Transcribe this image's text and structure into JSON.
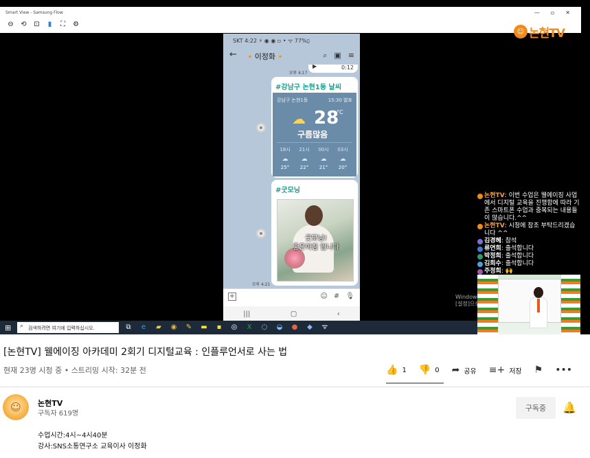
{
  "smart_view": {
    "title": "Smart View - Samsung Flow",
    "icons": [
      "minus-circle-icon",
      "rotate-icon",
      "crop-icon",
      "phone-icon",
      "fullscreen-icon",
      "settings-icon"
    ],
    "window_controls": [
      "—",
      "▫",
      "✕"
    ]
  },
  "logo": {
    "text": "논현TV"
  },
  "phone": {
    "status": "SKT 4:22 ⚡ ◉ ◉ ▫ •   ᯤ 77%▯",
    "chat_name": "🔸이정화🔸",
    "messages": [
      {
        "time": "오후 4:17",
        "partial_label": "0:12"
      },
      {
        "title": "#강남구 논현1동 날씨",
        "location": "강남구 논현1동",
        "updated": "15:30 발표",
        "temperature": "28",
        "unit": "°C",
        "condition": "구름많음",
        "forecast": [
          {
            "hour": "18시",
            "temp": "25°"
          },
          {
            "hour": "21시",
            "temp": "22°"
          },
          {
            "hour": "00시",
            "temp": "21°"
          },
          {
            "hour": "03시",
            "temp": "20°"
          }
        ]
      },
      {
        "title": "#굿모닝",
        "image_text_1": "굿모닝!",
        "image_text_2": "좋은아침 입니다",
        "time": "오후 4:21"
      }
    ]
  },
  "live_chat": [
    {
      "name": "논현TV",
      "text": ": 이번 수업은 웰에이징 사업에서 디지털 교육을 진행함에 따라 기존 스마트폰 수업과 중복되는 내용들이 많습니다.^^",
      "color": "#f08a1c"
    },
    {
      "name": "논현TV",
      "text": ": 시청에 참조 부탁드리겠습니다 ^^",
      "color": "#f08a1c"
    },
    {
      "name": "김경혜",
      "text": ": 참석",
      "color": "#7c6fd6"
    },
    {
      "name": "류연희",
      "text": ": 출석합니다",
      "color": "#3b7bd6"
    },
    {
      "name": "박정희",
      "text": ": 출석합니다",
      "color": "#2e9b6a"
    },
    {
      "name": "김희수",
      "text": ": 출석합니다",
      "color": "#4aa3d8"
    },
    {
      "name": "주정희",
      "text": ": 🙌",
      "color": "#9b59b6"
    }
  ],
  "watermark": [
    "Window",
    "[설정]으로"
  ],
  "taskbar": {
    "search_placeholder": "검색하려면 여기에 입력하십시오.",
    "apps": [
      "task-view-icon",
      "edge-icon",
      "explorer-icon",
      "chrome-icon",
      "paint-icon",
      "kakaotalk-icon",
      "sticky-notes-icon",
      "obs-icon",
      "excel-icon",
      "browser-icon",
      "samsung-flow-icon",
      "powerpoint-icon",
      "app-icon",
      "network-icon"
    ]
  },
  "video": {
    "title": "[논현TV] 웰에이징 아카데미 2회기 디지털교육 : 인플루언서로 사는 법",
    "meta": "현재 23명 시청 중 • 스트리밍 시작: 32분 전",
    "likes": "1",
    "dislikes": "0",
    "share_label": "공유",
    "save_label": "저장"
  },
  "channel": {
    "name": "논현TV",
    "subscribers": "구독자 619명",
    "subscribe_label": "구독중",
    "description": [
      "수업시간:4시~4시40분",
      "강사:SNS소통연구소 교육이사 이정화"
    ]
  }
}
